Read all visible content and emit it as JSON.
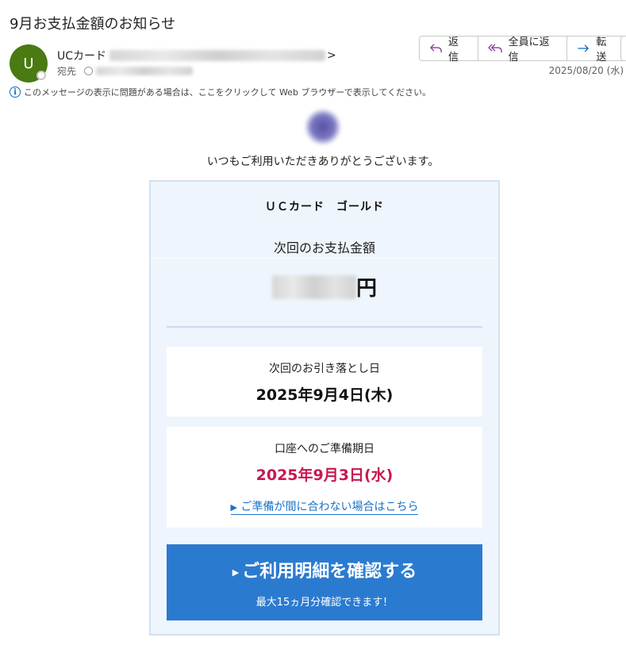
{
  "email": {
    "subject": "9月お支払金額のお知らせ",
    "avatar_initial": "U",
    "sender_name": "UCカード",
    "sender_suffix": ">",
    "to_label": "宛先",
    "date": "2025/08/20 (水)",
    "info_notice": "このメッセージの表示に問題がある場合は、ここをクリックして Web ブラウザーで表示してください。"
  },
  "toolbar": {
    "reply_label": "返信",
    "reply_all_label": "全員に返信",
    "forward_label": "転送"
  },
  "body": {
    "greeting": "いつもご利用いただきありがとうございます。",
    "card_name": "ＵＣカード　ゴールド",
    "next_payment_label": "次回のお支払金額",
    "currency": "円",
    "withdrawal_label": "次回のお引き落とし日",
    "withdrawal_date": "2025年9月4日(木)",
    "prepare_label": "口座へのご準備期日",
    "prepare_date": "2025年9月3日(水)",
    "late_link": "ご準備が間に合わない場合はこちら",
    "cta_label": "ご利用明細を確認する",
    "cta_sub": "最大15ヵ月分確認できます！"
  },
  "colors": {
    "accent_blue": "#2a7bd0",
    "due_date_red": "#c8174f",
    "avatar_green": "#4a7a12"
  }
}
